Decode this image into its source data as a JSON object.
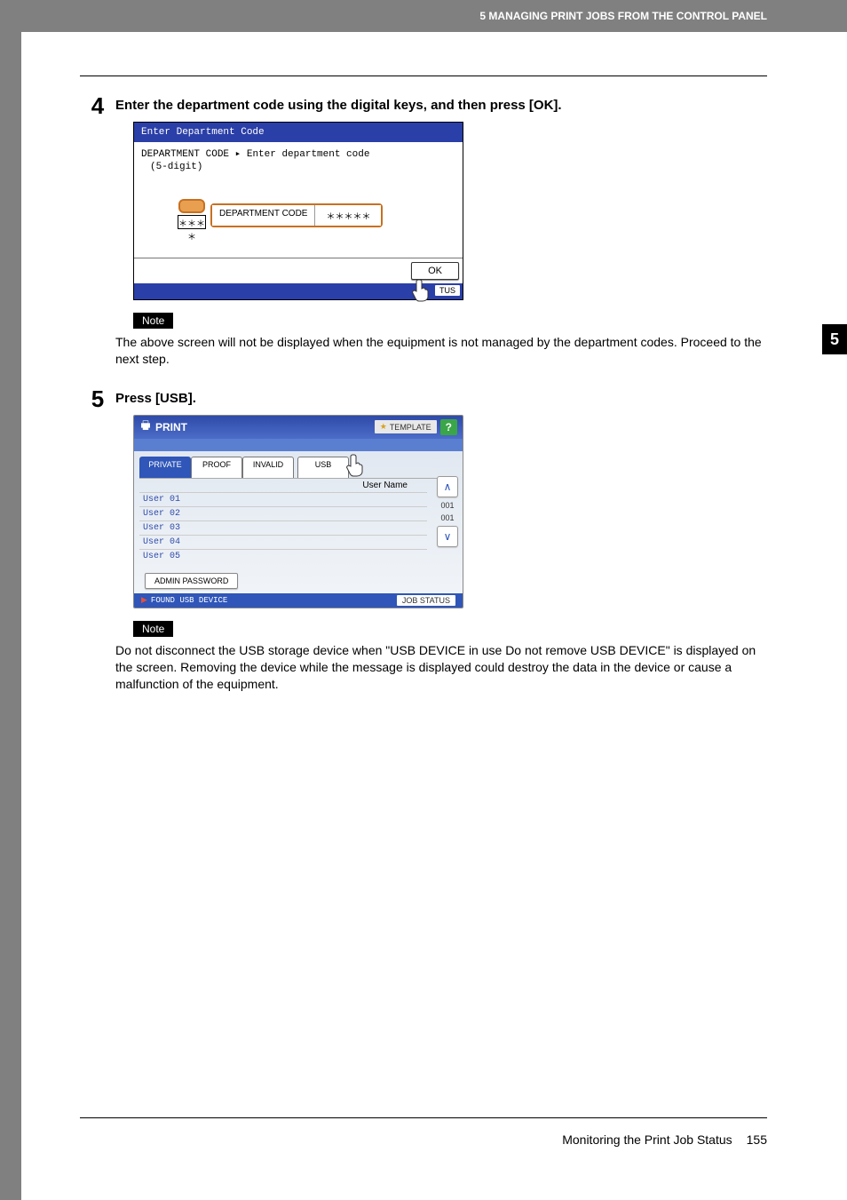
{
  "header": {
    "running": "5 MANAGING PRINT JOBS FROM THE CONTROL PANEL"
  },
  "side_tab": "5",
  "steps": {
    "s4": {
      "num": "4",
      "title": "Enter the department code using the digital keys, and then press [OK].",
      "note_label": "Note",
      "note_text": "The above screen will not be displayed when the equipment is not managed by the department codes. Proceed to the next step."
    },
    "s5": {
      "num": "5",
      "title": "Press [USB].",
      "note_label": "Note",
      "note_text": "Do not disconnect the USB storage device when \"USB DEVICE in use Do not remove USB DEVICE\" is displayed on the screen. Removing the device while the message is displayed could destroy the data in the device or cause a malfunction of the equipment."
    }
  },
  "scr_dept": {
    "title": "Enter Department Code",
    "line1": "DEPARTMENT CODE ▸ Enter department code",
    "line2": "(5-digit)",
    "keypad_b": "＊＊＊＊",
    "btn_label": "DEPARTMENT CODE",
    "btn_value": "＊＊＊＊＊",
    "ok": "OK",
    "status": "TUS"
  },
  "scr_print": {
    "title": "PRINT",
    "template": "TEMPLATE",
    "help": "?",
    "tabs": [
      "PRIVATE",
      "PROOF",
      "INVALID",
      "USB"
    ],
    "user_name_label": "User Name",
    "users": [
      "User 01",
      "User 02",
      "User 03",
      "User 04",
      "User 05"
    ],
    "pages_top": "001",
    "pages_bot": "001",
    "admin": "ADMIN PASSWORD",
    "found": "FOUND USB DEVICE",
    "job_status": "JOB STATUS"
  },
  "footer": {
    "title": "Monitoring the Print Job Status",
    "page": "155"
  }
}
